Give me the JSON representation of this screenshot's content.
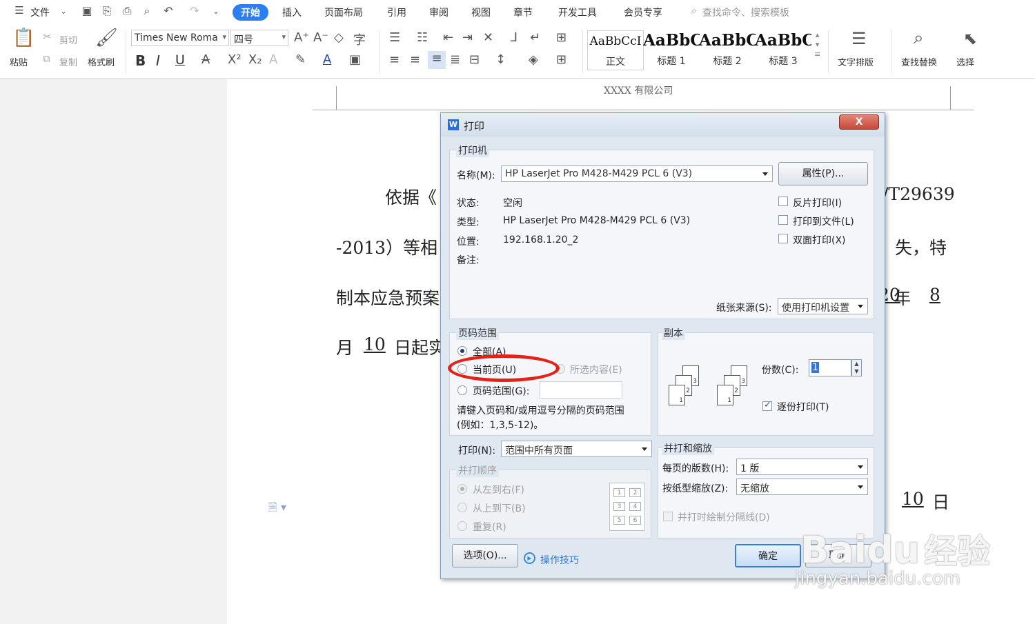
{
  "menubar": {
    "menu_label": "文件",
    "tabs": [
      "开始",
      "插入",
      "页面布局",
      "引用",
      "审阅",
      "视图",
      "章节",
      "开发工具",
      "会员专享"
    ],
    "search_placeholder": "查找命令、搜索模板",
    "active_color": "#2b7ff0"
  },
  "ribbon": {
    "paste": "粘贴",
    "cut": "剪切",
    "copy": "复制",
    "format_painter": "格式刷",
    "font_name": "Times New Roma",
    "font_size": "四号",
    "styles": [
      {
        "sample": "AaBbCcI",
        "name": "正文"
      },
      {
        "sample": "AaBbC",
        "name": "标题 1"
      },
      {
        "sample": "AaBbC",
        "name": "标题 2"
      },
      {
        "sample": "AaBbC",
        "name": "标题 3"
      }
    ],
    "text_layout": "文字排版",
    "find_replace": "查找替换",
    "select": "选择"
  },
  "document": {
    "header": "XXXX 有限公司",
    "line1_start": "依据《",
    "line1_end": "/T29639",
    "line2_start": "-2013）等相",
    "line2_end": "失，特",
    "line3_start": "制本应急预案",
    "line3_year": "20",
    "line3_year_char": "年",
    "line3_month": "8",
    "line4_prefix": "月",
    "line4_day": "10",
    "line4_rest": "日起实",
    "line5_num": "10",
    "line5_char": "日"
  },
  "dialog": {
    "title": "打印",
    "printer_group": "打印机",
    "name_label": "名称(M):",
    "printer_name": "HP LaserJet Pro M428-M429 PCL 6 (V3)",
    "properties_button": "属性(P)...",
    "status_label": "状态:",
    "status_value": "空闲",
    "type_label": "类型:",
    "type_value": "HP LaserJet Pro M428-M429 PCL 6 (V3)",
    "location_label": "位置:",
    "location_value": "192.168.1.20_2",
    "comment_label": "备注:",
    "reverse_print": "反片打印(I)",
    "print_to_file": "打印到文件(L)",
    "duplex_print": "双面打印(X)",
    "paper_source_label": "纸张来源(S):",
    "paper_source_value": "使用打印机设置",
    "range_group": "页码范围",
    "range_all": "全部(A)",
    "range_current": "当前页(U)",
    "range_selection": "所选内容(E)",
    "range_pages": "页码范围(G):",
    "range_hint_1": "请键入页码和/或用逗号分隔的页码范围",
    "range_hint_2": "(例如：1,3,5-12)。",
    "copies_group": "副本",
    "copies_label": "份数(C):",
    "copies_value": "1",
    "collate_label": "逐份打印(T)",
    "print_label": "打印(N):",
    "print_value": "范围中所有页面",
    "order_group": "并打顺序",
    "order_lr": "从左到右(F)",
    "order_tb": "从上到下(B)",
    "order_repeat": "重复(R)",
    "order_grid": [
      "1",
      "2",
      "3",
      "4",
      "5",
      "6"
    ],
    "scale_group": "并打和缩放",
    "pages_per_sheet_label": "每页的版数(H):",
    "pages_per_sheet_value": "1 版",
    "scale_label": "按纸型缩放(Z):",
    "scale_value": "无缩放",
    "draw_borders": "并打时绘制分隔线(D)",
    "options_button": "选项(O)...",
    "tips_link": "操作技巧",
    "ok_button": "确定",
    "cancel_button": "取消",
    "close_button": "X",
    "close_color": "#c9483b"
  },
  "highlight": {
    "color": "#e2231a"
  },
  "watermark": {
    "brand": "Bai",
    "paw": "du",
    "cn": "经验",
    "url": "jingyan.baidu.com"
  }
}
